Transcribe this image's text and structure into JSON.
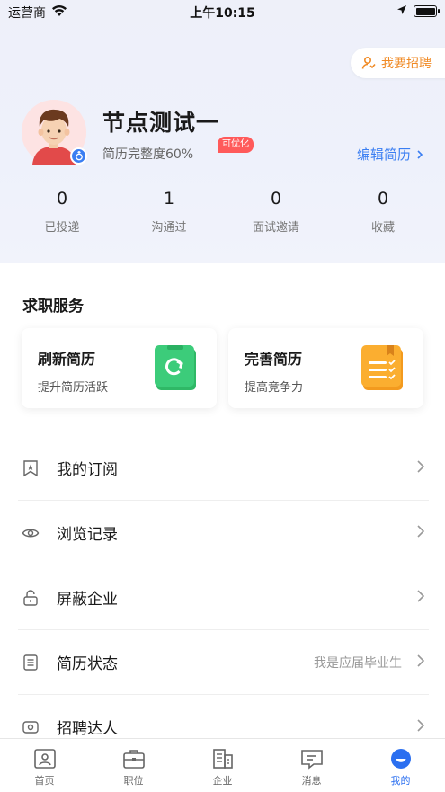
{
  "status_bar": {
    "carrier": "运营商",
    "time": "上午10:15"
  },
  "recruit_button": {
    "label": "我要招聘"
  },
  "profile": {
    "name": "节点测试一",
    "completeness": "简历完整度60%",
    "optimize_tag": "可优化",
    "edit_resume": "编辑简历"
  },
  "stats": [
    {
      "value": "0",
      "label": "已投递"
    },
    {
      "value": "1",
      "label": "沟通过"
    },
    {
      "value": "0",
      "label": "面试邀请"
    },
    {
      "value": "0",
      "label": "收藏"
    }
  ],
  "services": {
    "title": "求职服务",
    "cards": [
      {
        "title": "刷新简历",
        "subtitle": "提升简历活跃",
        "icon": "refresh-icon",
        "color": "#3ccc7a"
      },
      {
        "title": "完善简历",
        "subtitle": "提高竞争力",
        "icon": "document-icon",
        "color": "#fbae30"
      }
    ]
  },
  "menu": [
    {
      "label": "我的订阅",
      "value": "",
      "icon": "bookmark-icon"
    },
    {
      "label": "浏览记录",
      "value": "",
      "icon": "eye-icon"
    },
    {
      "label": "屏蔽企业",
      "value": "",
      "icon": "lock-icon"
    },
    {
      "label": "简历状态",
      "value": "我是应届毕业生",
      "icon": "list-icon"
    },
    {
      "label": "招聘达人",
      "value": "",
      "icon": "badge-icon"
    }
  ],
  "tabbar": [
    {
      "label": "首页",
      "icon": "home-icon",
      "active": false
    },
    {
      "label": "职位",
      "icon": "briefcase-icon",
      "active": false
    },
    {
      "label": "企业",
      "icon": "building-icon",
      "active": false
    },
    {
      "label": "消息",
      "icon": "message-icon",
      "active": false
    },
    {
      "label": "我的",
      "icon": "profile-icon",
      "active": true
    }
  ],
  "colors": {
    "accent": "#3a7ef2",
    "recruit": "#f08a24",
    "tag": "#ff5a5a"
  }
}
